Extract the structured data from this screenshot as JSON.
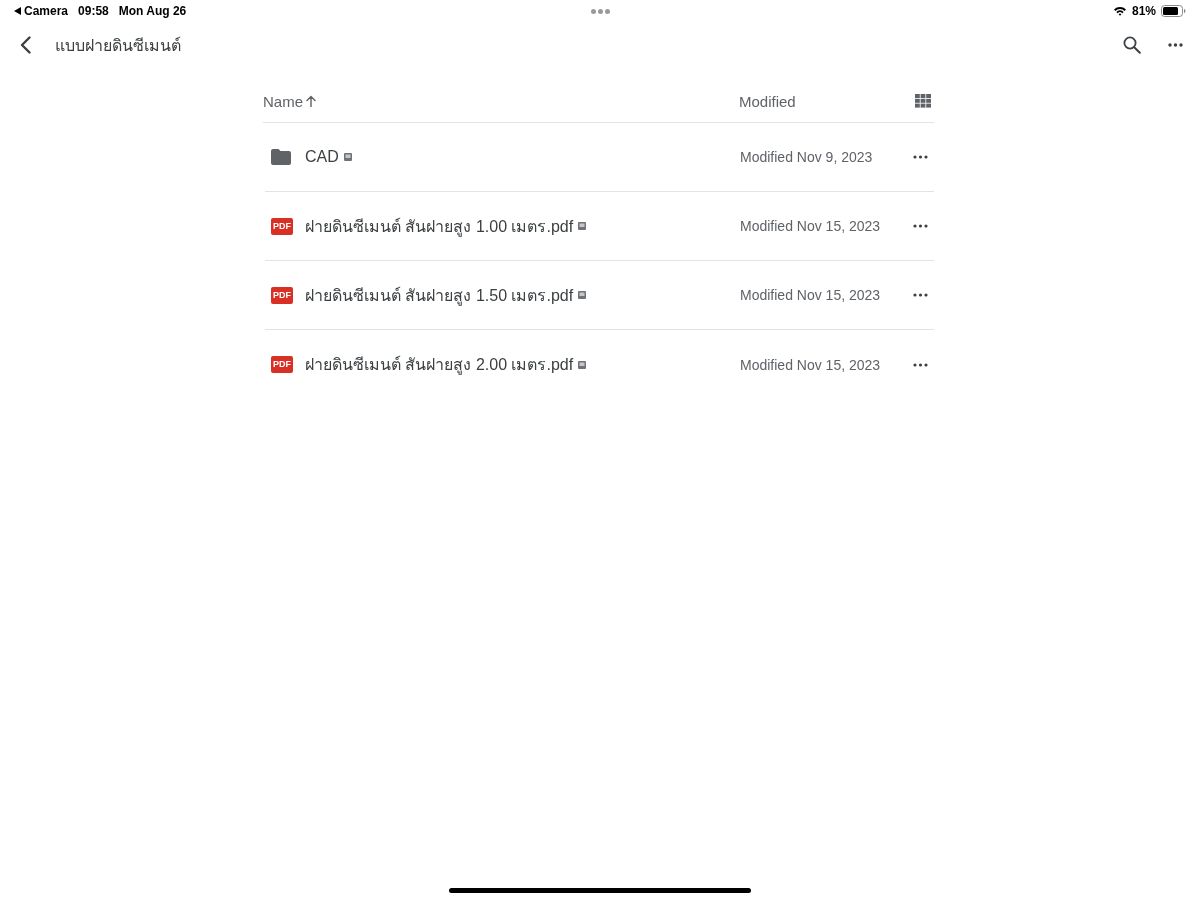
{
  "status_bar": {
    "back_app": "Camera",
    "time": "09:58",
    "date": "Mon Aug 26",
    "battery": "81%"
  },
  "nav": {
    "title": "แบบฝายดินซีเมนต์"
  },
  "list_header": {
    "name_label": "Name",
    "sort_ascending": true,
    "modified_label": "Modified"
  },
  "items": [
    {
      "kind": "folder",
      "name": "CAD",
      "modified": "Modified Nov 9, 2023"
    },
    {
      "kind": "pdf",
      "type_label": "PDF",
      "name": "ฝายดินซีเมนต์ สันฝายสูง 1.00 เมตร.pdf",
      "modified": "Modified Nov 15, 2023"
    },
    {
      "kind": "pdf",
      "type_label": "PDF",
      "name": "ฝายดินซีเมนต์ สันฝายสูง 1.50 เมตร.pdf",
      "modified": "Modified Nov 15, 2023"
    },
    {
      "kind": "pdf",
      "type_label": "PDF",
      "name": "ฝายดินซีเมนต์ สันฝายสูง 2.00 เมตร.pdf",
      "modified": "Modified Nov 15, 2023"
    }
  ]
}
